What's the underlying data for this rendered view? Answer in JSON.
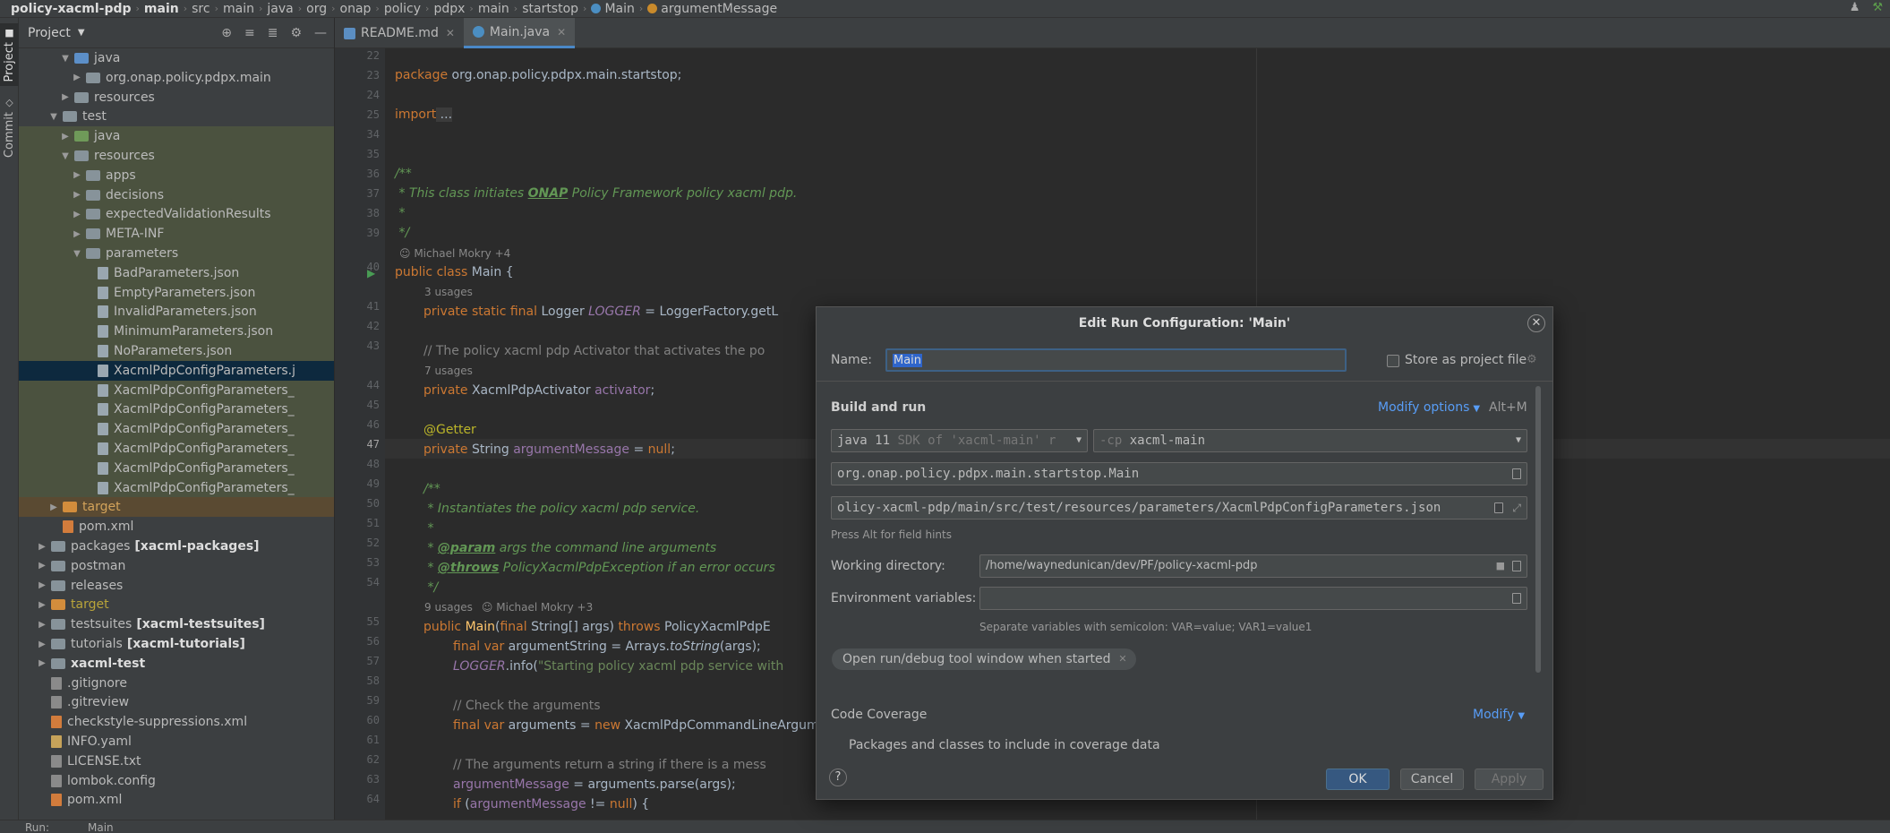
{
  "breadcrumb": [
    "policy-xacml-pdp",
    "main",
    "src",
    "main",
    "java",
    "org",
    "onap",
    "policy",
    "pdpx",
    "main",
    "startstop",
    "Main",
    "argumentMessage"
  ],
  "left_stripe": {
    "project": "Project",
    "commit": "Commit"
  },
  "project_panel": {
    "title": "Project"
  },
  "tree": [
    {
      "label": "java",
      "depth": 3,
      "icon": "folder-blue",
      "arrow": "open",
      "hl": false
    },
    {
      "label": "org.onap.policy.pdpx.main",
      "depth": 4,
      "icon": "folder",
      "arrow": "closed",
      "hl": false
    },
    {
      "label": "resources",
      "depth": 3,
      "icon": "folder",
      "arrow": "closed",
      "hl": false
    },
    {
      "label": "test",
      "depth": 2,
      "icon": "folder",
      "arrow": "open",
      "hl": false
    },
    {
      "label": "java",
      "depth": 3,
      "icon": "folder-test",
      "arrow": "closed",
      "hl": true
    },
    {
      "label": "resources",
      "depth": 3,
      "icon": "folder",
      "arrow": "open",
      "hl": true
    },
    {
      "label": "apps",
      "depth": 4,
      "icon": "folder",
      "arrow": "closed",
      "hl": true
    },
    {
      "label": "decisions",
      "depth": 4,
      "icon": "folder",
      "arrow": "closed",
      "hl": true
    },
    {
      "label": "expectedValidationResults",
      "depth": 4,
      "icon": "folder",
      "arrow": "closed",
      "hl": true
    },
    {
      "label": "META-INF",
      "depth": 4,
      "icon": "folder",
      "arrow": "closed",
      "hl": true
    },
    {
      "label": "parameters",
      "depth": 4,
      "icon": "folder",
      "arrow": "open",
      "hl": true
    },
    {
      "label": "BadParameters.json",
      "depth": 5,
      "icon": "json",
      "arrow": "",
      "hl": true
    },
    {
      "label": "EmptyParameters.json",
      "depth": 5,
      "icon": "json",
      "arrow": "",
      "hl": true
    },
    {
      "label": "InvalidParameters.json",
      "depth": 5,
      "icon": "json",
      "arrow": "",
      "hl": true
    },
    {
      "label": "MinimumParameters.json",
      "depth": 5,
      "icon": "json",
      "arrow": "",
      "hl": true
    },
    {
      "label": "NoParameters.json",
      "depth": 5,
      "icon": "json",
      "arrow": "",
      "hl": true
    },
    {
      "label": "XacmlPdpConfigParameters.j",
      "depth": 5,
      "icon": "json",
      "arrow": "",
      "hl": false,
      "sel": true
    },
    {
      "label": "XacmlPdpConfigParameters_",
      "depth": 5,
      "icon": "json",
      "arrow": "",
      "hl": true
    },
    {
      "label": "XacmlPdpConfigParameters_",
      "depth": 5,
      "icon": "json",
      "arrow": "",
      "hl": true
    },
    {
      "label": "XacmlPdpConfigParameters_",
      "depth": 5,
      "icon": "json",
      "arrow": "",
      "hl": true
    },
    {
      "label": "XacmlPdpConfigParameters_",
      "depth": 5,
      "icon": "json",
      "arrow": "",
      "hl": true
    },
    {
      "label": "XacmlPdpConfigParameters_",
      "depth": 5,
      "icon": "json",
      "arrow": "",
      "hl": true
    },
    {
      "label": "XacmlPdpConfigParameters_",
      "depth": 5,
      "icon": "json",
      "arrow": "",
      "hl": true
    },
    {
      "label": "target",
      "depth": 2,
      "icon": "folder-orange",
      "arrow": "closed",
      "tg": true,
      "cls": "orange"
    },
    {
      "label": "pom.xml",
      "depth": 2,
      "icon": "xml",
      "arrow": "",
      "hl": false
    },
    {
      "label": "packages",
      "bold": "[xacml-packages]",
      "depth": 1,
      "icon": "folder",
      "arrow": "closed",
      "hl": false
    },
    {
      "label": "postman",
      "depth": 1,
      "icon": "folder",
      "arrow": "closed",
      "hl": false
    },
    {
      "label": "releases",
      "depth": 1,
      "icon": "folder",
      "arrow": "closed",
      "hl": false
    },
    {
      "label": "target",
      "depth": 1,
      "icon": "folder-orange",
      "arrow": "closed",
      "hl": false,
      "cls": "olive"
    },
    {
      "label": "testsuites",
      "bold": "[xacml-testsuites]",
      "depth": 1,
      "icon": "folder",
      "arrow": "closed",
      "hl": false
    },
    {
      "label": "tutorials",
      "bold": "[xacml-tutorials]",
      "depth": 1,
      "icon": "folder",
      "arrow": "closed",
      "hl": false
    },
    {
      "label": "xacml-test",
      "depth": 1,
      "icon": "folder",
      "arrow": "closed",
      "hl": false,
      "allbold": true
    },
    {
      "label": ".gitignore",
      "depth": 1,
      "icon": "file",
      "arrow": "",
      "hl": false
    },
    {
      "label": ".gitreview",
      "depth": 1,
      "icon": "file",
      "arrow": "",
      "hl": false
    },
    {
      "label": "checkstyle-suppressions.xml",
      "depth": 1,
      "icon": "xml",
      "arrow": "",
      "hl": false
    },
    {
      "label": "INFO.yaml",
      "depth": 1,
      "icon": "yaml",
      "arrow": "",
      "hl": false
    },
    {
      "label": "LICENSE.txt",
      "depth": 1,
      "icon": "file",
      "arrow": "",
      "hl": false
    },
    {
      "label": "lombok.config",
      "depth": 1,
      "icon": "file",
      "arrow": "",
      "hl": false
    },
    {
      "label": "pom.xml",
      "depth": 1,
      "icon": "xml",
      "arrow": "",
      "hl": false
    }
  ],
  "editor_tabs": [
    {
      "label": "README.md",
      "active": false
    },
    {
      "label": "Main.java",
      "active": true
    }
  ],
  "line_numbers": [
    "22",
    "23",
    "24",
    "25",
    "34",
    "35",
    "36",
    "37",
    "38",
    "39",
    "40",
    "41",
    "42",
    "43",
    "44",
    "45",
    "46",
    "47",
    "48",
    "49",
    "50",
    "51",
    "52",
    "53",
    "54",
    "55",
    "56",
    "57",
    "58",
    "59",
    "60",
    "61",
    "62",
    "63",
    "64"
  ],
  "code": {
    "l23_kw": "package",
    "l23_rest": " org.onap.policy.pdpx.main.startstop;",
    "l25_kw": "import",
    "l25_rest": " ...",
    "l36": "/**",
    "l37a": " * This class initiates ",
    "l37b": "ONAP",
    "l37c": " Policy Framework policy xacml pdp.",
    "l38": " *",
    "l39": " */",
    "author1": "Michael Mokry +4",
    "l40_kw": "public class",
    "l40_rest": " Main {",
    "usages3": "3 usages",
    "l41_kw": "private static final",
    "l41_type": " Logger ",
    "l41_field": "LOGGER",
    "l41_rest": " = LoggerFactory.getL",
    "l43": "// The policy xacml pdp Activator that activates the po",
    "usages7": "7 usages",
    "l44_kw": "private",
    "l44_type": " XacmlPdpActivator ",
    "l44_field": "activator",
    "l44_rest": ";",
    "l46": "@Getter",
    "l47_kw": "private",
    "l47_type": " String ",
    "l47_field": "argumentMessage",
    "l47_eq": " = ",
    "l47_null": "null",
    "l47_rest": ";",
    "l49": "/**",
    "l50": " * Instantiates the policy xacml pdp service.",
    "l51": " *",
    "l52a": " * ",
    "l52tag": "@param",
    "l52b": " args the command line arguments",
    "l53a": " * ",
    "l53tag": "@throws",
    "l53b": " PolicyXacmlPdpException if an error occurs",
    "l54": " */",
    "usages9": "9 usages",
    "author2": "Michael Mokry +3",
    "l55_kw": "public",
    "l55_fn": " Main",
    "l55_a": "(",
    "l55_kw2": "final",
    "l55_b": " String[] args) ",
    "l55_kw3": "throws",
    "l55_c": " PolicyXacmlPdpE",
    "l56_kw": "final var",
    "l56_rest": " argumentString = Arrays.",
    "l56_it": "toString",
    "l56_end": "(args);",
    "l57_field": "LOGGER",
    "l57_a": ".info(",
    "l57_str": "\"Starting policy xacml pdp service with",
    "l59": "// Check the arguments",
    "l60_kw": "final var",
    "l60_rest": " arguments = ",
    "l60_kw2": "new",
    "l60_end": " XacmlPdpCommandLineArgume",
    "l62": "// The arguments return a string if there is a mess",
    "l63_field": "argumentMessage",
    "l63_rest": " = arguments.parse(args);",
    "l64_kw": "if",
    "l64_a": " (",
    "l64_field": "argumentMessage",
    "l64_b": " != ",
    "l64_null": "null",
    "l64_c": ") {"
  },
  "dialog": {
    "title": "Edit Run Configuration: 'Main'",
    "name_label": "Name:",
    "name_value": "Main",
    "store_label": "Store as project file",
    "build_run": "Build and run",
    "modify_options": "Modify options",
    "modify_shortcut": "Alt+M",
    "jdk_value": "java 11",
    "jdk_hint": "SDK of 'xacml-main' r",
    "cp_prefix": "-cp",
    "cp_value": "xacml-main",
    "main_class": "org.onap.policy.pdpx.main.startstop.Main",
    "program_args": "olicy-xacml-pdp/main/src/test/resources/parameters/XacmlPdpConfigParameters.json",
    "field_hint": "Press Alt for field hints",
    "workdir_label": "Working directory:",
    "workdir_value": "/home/waynedunican/dev/PF/policy-xacml-pdp",
    "env_label": "Environment variables:",
    "env_value": "",
    "env_hint": "Separate variables with semicolon: VAR=value; VAR1=value1",
    "chip": "Open run/debug tool window when started",
    "code_coverage": "Code Coverage",
    "modify": "Modify",
    "packages_text": "Packages and classes to include in coverage data",
    "ok": "OK",
    "cancel": "Cancel",
    "apply": "Apply",
    "help": "?"
  },
  "bottom": {
    "run_label": "Run:",
    "run_config": "Main"
  },
  "colors": {
    "accent": "#589df6",
    "selection": "#0d293e",
    "test_highlight": "#4b523f"
  }
}
